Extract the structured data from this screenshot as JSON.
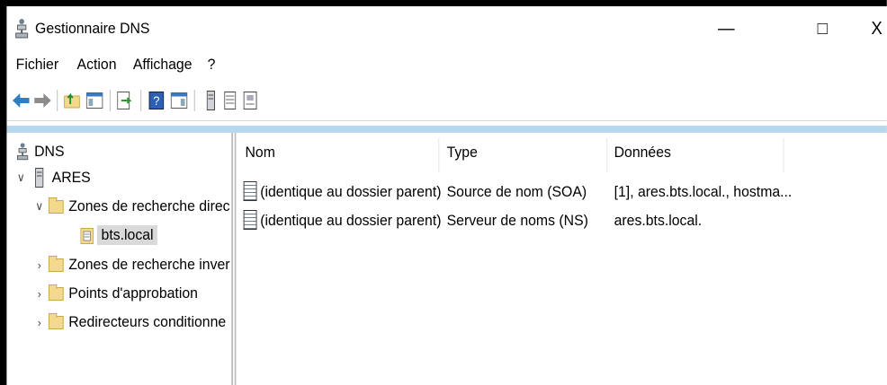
{
  "window": {
    "title": "Gestionnaire DNS",
    "icon": "dns-server-icon",
    "controls": {
      "minimize": "—",
      "maximize": "□",
      "close": "X"
    }
  },
  "menu": [
    "Fichier",
    "Action",
    "Affichage",
    "?"
  ],
  "toolbar": [
    "back-arrow-icon",
    "forward-arrow-icon",
    "up-folder-icon",
    "show-console-tree-icon",
    "export-list-icon",
    "help-icon",
    "show-action-pane-icon",
    "server-icon",
    "list-icon",
    "properties-icon"
  ],
  "tree": {
    "root": "DNS",
    "server": "ARES",
    "forward_zones": "Zones de recherche direc",
    "selected_zone": "bts.local",
    "reverse_zones": "Zones de recherche inver",
    "trust_points": "Points d'approbation",
    "conditional_forwarders": "Redirecteurs conditionne"
  },
  "list": {
    "columns": [
      "Nom",
      "Type",
      "Données"
    ],
    "rows": [
      {
        "name": "(identique au dossier parent)",
        "type": "Source de nom (SOA)",
        "data": "[1], ares.bts.local., hostma..."
      },
      {
        "name": "(identique au dossier parent)",
        "type": "Serveur de noms (NS)",
        "data": "ares.bts.local."
      }
    ]
  }
}
